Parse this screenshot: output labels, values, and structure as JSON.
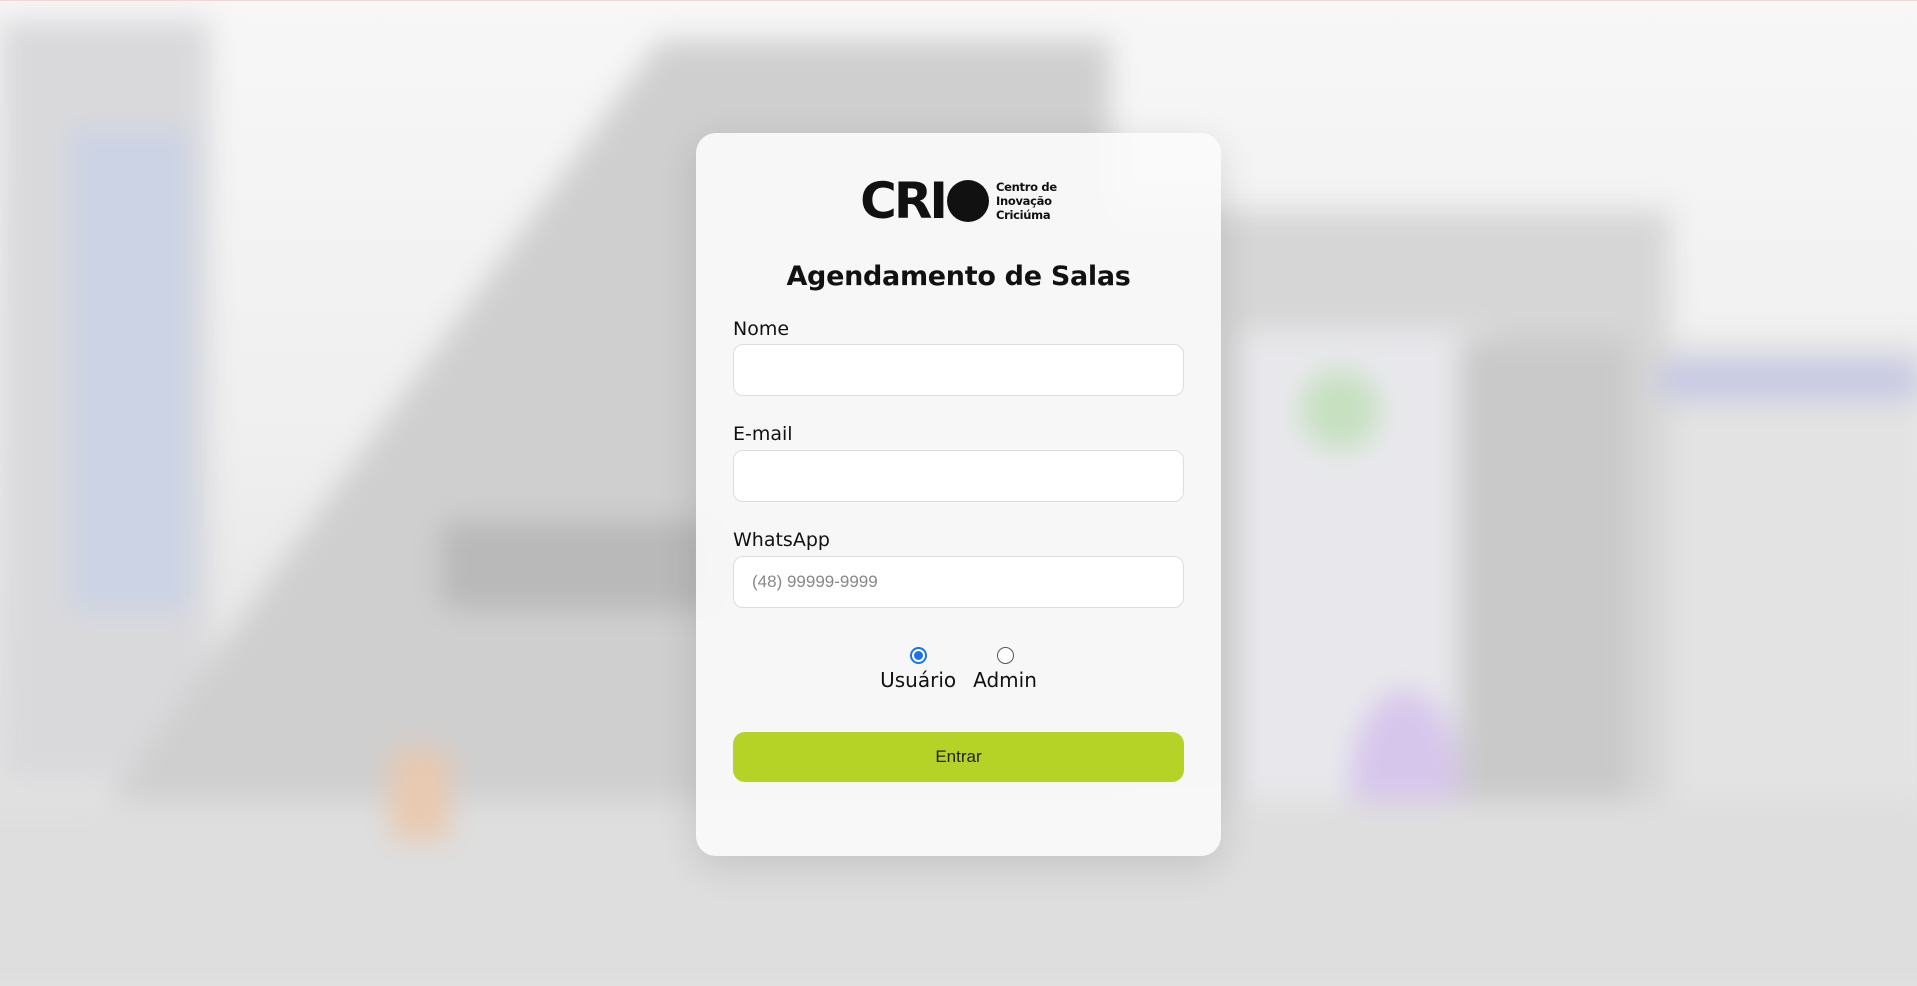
{
  "logo": {
    "wordmark": "CRI",
    "subtitle_lines": [
      "Centro de",
      "Inovação",
      "Criciúma"
    ]
  },
  "form": {
    "title": "Agendamento de Salas",
    "nome": {
      "label": "Nome",
      "value": "",
      "placeholder": ""
    },
    "email": {
      "label": "E-mail",
      "value": "",
      "placeholder": ""
    },
    "whatsapp": {
      "label": "WhatsApp",
      "value": "",
      "placeholder": "(48) 99999-9999"
    },
    "roles": [
      {
        "label": "Usuário",
        "checked": true
      },
      {
        "label": "Admin",
        "checked": false
      }
    ],
    "submit_label": "Entrar"
  },
  "colors": {
    "accent": "#b5d327",
    "radio_checked": "#1a73e8"
  }
}
